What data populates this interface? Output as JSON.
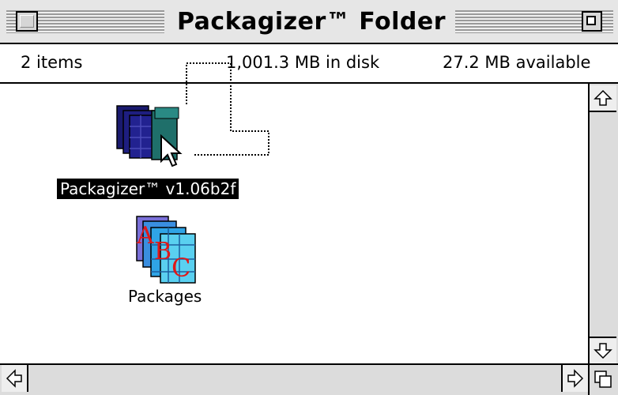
{
  "window": {
    "title": "Packagizer™ Folder"
  },
  "infobar": {
    "items": "2 items",
    "disk": "1,001.3 MB in disk",
    "available": "27.2 MB available"
  },
  "files": [
    {
      "label": "Packagizer™ v1.06b2f",
      "icon": "packagizer-app-icon",
      "selected": true
    },
    {
      "label": "Packages",
      "icon": "packages-folder-icon",
      "selected": false
    }
  ],
  "colors": {
    "selection": "#000000",
    "app_icon_dark": "#1a1a6e",
    "app_icon_teal": "#1f6f6a",
    "packages_blue": "#2a9ad8",
    "packages_letters": "#e01818"
  }
}
